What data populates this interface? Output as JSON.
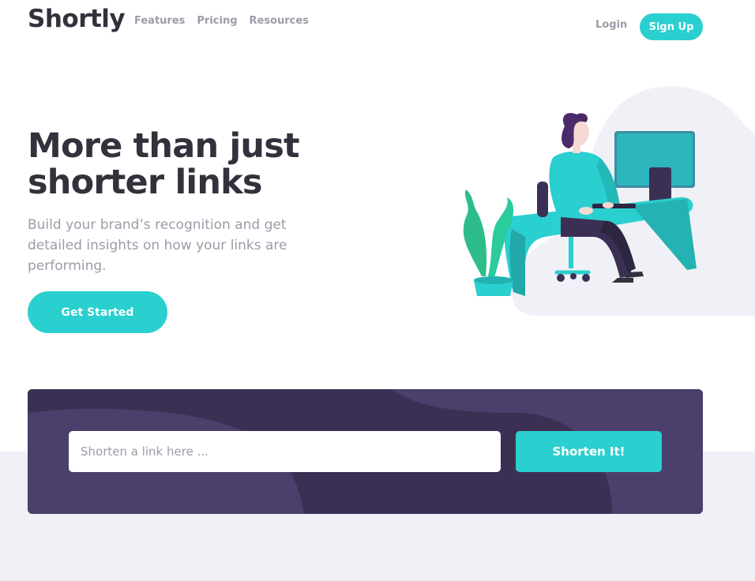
{
  "header": {
    "logo": "Shortly",
    "nav": [
      {
        "label": "Features"
      },
      {
        "label": "Pricing"
      },
      {
        "label": "Resources"
      }
    ],
    "login_label": "Login",
    "signup_label": "Sign Up"
  },
  "hero": {
    "title": "More than just shorter links",
    "text": "Build your brand’s recognition and get detailed insights on how your links are performing.",
    "cta_label": "Get Started",
    "illustration_icon": "person-working-at-desk-illustration"
  },
  "shorten": {
    "placeholder": "Shorten a link here ...",
    "value": "",
    "button_label": "Shorten It!"
  },
  "colors": {
    "primary": "#2acfcf",
    "dark_violet": "#3b3054",
    "grayish_violet": "#9e9aa8",
    "very_dark_blue": "#34313d",
    "light_gray": "#f0f1f6"
  }
}
